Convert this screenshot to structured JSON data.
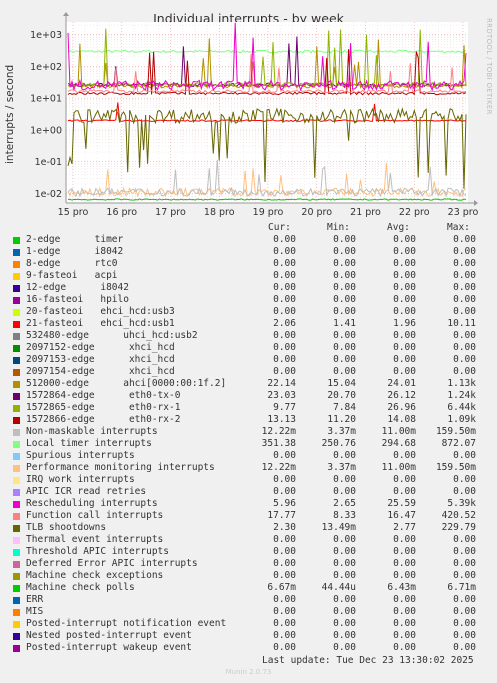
{
  "chart_data": {
    "type": "line",
    "title": "Individual interrupts - by week",
    "ylabel": "interrupts / second",
    "yscale": "log",
    "ylim": [
      0.005,
      2500
    ],
    "yticks": [
      "1e-02",
      "1e-01",
      "1e+00",
      "1e+01",
      "1e+02",
      "1e+03"
    ],
    "yticks_values": [
      0.01,
      0.1,
      1,
      10,
      100,
      1000
    ],
    "xticks": [
      "15 pro",
      "16 pro",
      "17 pro",
      "18 pro",
      "19 pro",
      "20 pro",
      "21 pro",
      "22 pro",
      "23 pro"
    ],
    "side_label": "RRDTOOL / TOBI OETIKER",
    "columns": [
      "Cur:",
      "Min:",
      "Avg:",
      "Max:"
    ],
    "series": [
      {
        "name": "2-edge      timer",
        "color": "#00cc00",
        "cur": "0.00",
        "min": "0.00",
        "avg": "0.00",
        "max": "0.00"
      },
      {
        "name": "1-edge      i8042",
        "color": "#0066b3",
        "cur": "0.00",
        "min": "0.00",
        "avg": "0.00",
        "max": "0.00"
      },
      {
        "name": "8-edge      rtc0",
        "color": "#ff8000",
        "cur": "0.00",
        "min": "0.00",
        "avg": "0.00",
        "max": "0.00"
      },
      {
        "name": "9-fasteoi   acpi",
        "color": "#ffcc00",
        "cur": "0.00",
        "min": "0.00",
        "avg": "0.00",
        "max": "0.00"
      },
      {
        "name": "12-edge      i8042",
        "color": "#330099",
        "cur": "0.00",
        "min": "0.00",
        "avg": "0.00",
        "max": "0.00"
      },
      {
        "name": "16-fasteoi   hpilo",
        "color": "#990099",
        "cur": "0.00",
        "min": "0.00",
        "avg": "0.00",
        "max": "0.00"
      },
      {
        "name": "20-fasteoi   ehci_hcd:usb3",
        "color": "#ccff00",
        "cur": "0.00",
        "min": "0.00",
        "avg": "0.00",
        "max": "0.00"
      },
      {
        "name": "21-fasteoi   ehci_hcd:usb1",
        "color": "#ff0000",
        "cur": "2.06",
        "min": "1.41",
        "avg": "1.96",
        "max": "10.11"
      },
      {
        "name": "532480-edge      uhci_hcd:usb2",
        "color": "#808080",
        "cur": "0.00",
        "min": "0.00",
        "avg": "0.00",
        "max": "0.00"
      },
      {
        "name": "2097152-edge      xhci_hcd",
        "color": "#008f00",
        "cur": "0.00",
        "min": "0.00",
        "avg": "0.00",
        "max": "0.00"
      },
      {
        "name": "2097153-edge      xhci_hcd",
        "color": "#00487d",
        "cur": "0.00",
        "min": "0.00",
        "avg": "0.00",
        "max": "0.00"
      },
      {
        "name": "2097154-edge      xhci_hcd",
        "color": "#b35a00",
        "cur": "0.00",
        "min": "0.00",
        "avg": "0.00",
        "max": "0.00"
      },
      {
        "name": "512000-edge      ahci[0000:00:1f.2]",
        "color": "#b38f00",
        "cur": "22.14",
        "min": "15.04",
        "avg": "24.01",
        "max": "1.13k"
      },
      {
        "name": "1572864-edge      eth0-tx-0",
        "color": "#6b006b",
        "cur": "23.03",
        "min": "20.70",
        "avg": "26.12",
        "max": "1.24k"
      },
      {
        "name": "1572865-edge      eth0-rx-1",
        "color": "#8fb300",
        "cur": "9.77",
        "min": "7.84",
        "avg": "26.96",
        "max": "6.44k"
      },
      {
        "name": "1572866-edge      eth0-rx-2",
        "color": "#b30000",
        "cur": "13.13",
        "min": "11.20",
        "avg": "14.08",
        "max": "1.09k"
      },
      {
        "name": "Non-maskable interrupts",
        "color": "#bebebe",
        "cur": "12.22m",
        "min": "3.37m",
        "avg": "11.00m",
        "max": "159.50m"
      },
      {
        "name": "Local timer interrupts",
        "color": "#80ff80",
        "cur": "351.38",
        "min": "250.76",
        "avg": "294.68",
        "max": "872.07"
      },
      {
        "name": "Spurious interrupts",
        "color": "#80c9ff",
        "cur": "0.00",
        "min": "0.00",
        "avg": "0.00",
        "max": "0.00"
      },
      {
        "name": "Performance monitoring interrupts",
        "color": "#ffc080",
        "cur": "12.22m",
        "min": "3.37m",
        "avg": "11.00m",
        "max": "159.50m"
      },
      {
        "name": "IRQ work interrupts",
        "color": "#ffe680",
        "cur": "0.00",
        "min": "0.00",
        "avg": "0.00",
        "max": "0.00"
      },
      {
        "name": "APIC ICR read retries",
        "color": "#aa80ff",
        "cur": "0.00",
        "min": "0.00",
        "avg": "0.00",
        "max": "0.00"
      },
      {
        "name": "Rescheduling interrupts",
        "color": "#ee00cc",
        "cur": "5.96",
        "min": "2.65",
        "avg": "25.59",
        "max": "5.39k"
      },
      {
        "name": "Function call interrupts",
        "color": "#ff8080",
        "cur": "17.77",
        "min": "8.33",
        "avg": "16.47",
        "max": "420.52"
      },
      {
        "name": "TLB shootdowns",
        "color": "#666600",
        "cur": "2.30",
        "min": "13.49m",
        "avg": "2.77",
        "max": "229.79"
      },
      {
        "name": "Thermal event interrupts",
        "color": "#ffbfff",
        "cur": "0.00",
        "min": "0.00",
        "avg": "0.00",
        "max": "0.00"
      },
      {
        "name": "Threshold APIC interrupts",
        "color": "#00ffcc",
        "cur": "0.00",
        "min": "0.00",
        "avg": "0.00",
        "max": "0.00"
      },
      {
        "name": "Deferred Error APIC interrupts",
        "color": "#cc6699",
        "cur": "0.00",
        "min": "0.00",
        "avg": "0.00",
        "max": "0.00"
      },
      {
        "name": "Machine check exceptions",
        "color": "#999900",
        "cur": "0.00",
        "min": "0.00",
        "avg": "0.00",
        "max": "0.00"
      },
      {
        "name": "Machine check polls",
        "color": "#00cc00",
        "cur": "6.67m",
        "min": "44.44u",
        "avg": "6.43m",
        "max": "6.71m"
      },
      {
        "name": "ERR",
        "color": "#0066b3",
        "cur": "0.00",
        "min": "0.00",
        "avg": "0.00",
        "max": "0.00"
      },
      {
        "name": "MIS",
        "color": "#ff8000",
        "cur": "0.00",
        "min": "0.00",
        "avg": "0.00",
        "max": "0.00"
      },
      {
        "name": "Posted-interrupt notification event",
        "color": "#ffcc00",
        "cur": "0.00",
        "min": "0.00",
        "avg": "0.00",
        "max": "0.00"
      },
      {
        "name": "Nested posted-interrupt event",
        "color": "#330099",
        "cur": "0.00",
        "min": "0.00",
        "avg": "0.00",
        "max": "0.00"
      },
      {
        "name": "Posted-interrupt wakeup event",
        "color": "#990099",
        "cur": "0.00",
        "min": "0.00",
        "avg": "0.00",
        "max": "0.00"
      }
    ]
  },
  "footer": {
    "last_update": "Last update: Tue Dec 23 13:30:02 2025",
    "munin": "Munin 2.0.73"
  }
}
